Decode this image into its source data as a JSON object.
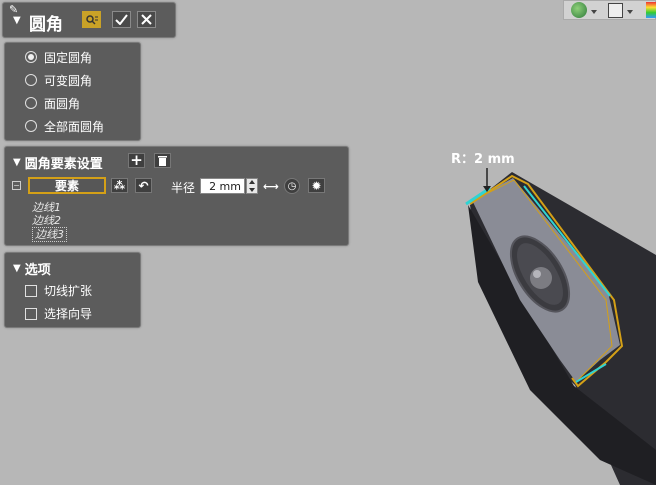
{
  "title_panel": {
    "title": "圆角"
  },
  "fillet_type": {
    "options": [
      {
        "label": "固定圆角",
        "selected": true
      },
      {
        "label": "可变圆角",
        "selected": false
      },
      {
        "label": "面圆角",
        "selected": false
      },
      {
        "label": "全部面圆角",
        "selected": false
      }
    ]
  },
  "element_settings": {
    "header": "圆角要素设置",
    "element_button": "要素",
    "radius_label": "半径",
    "radius_value": "2 mm",
    "edges": [
      "边线1",
      "边线2",
      "边线3"
    ]
  },
  "options_panel": {
    "header": "选项",
    "items": [
      {
        "label": "切线扩张",
        "checked": false
      },
      {
        "label": "选择向导",
        "checked": false
      }
    ]
  },
  "viewport": {
    "dimension_label": "R：2 mm"
  },
  "colors": {
    "panel_bg": "#5c5c5c",
    "viewport_bg": "#b7b7b7",
    "highlight_orange": "#d4a017",
    "edge_cyan": "#2fd3d3"
  }
}
